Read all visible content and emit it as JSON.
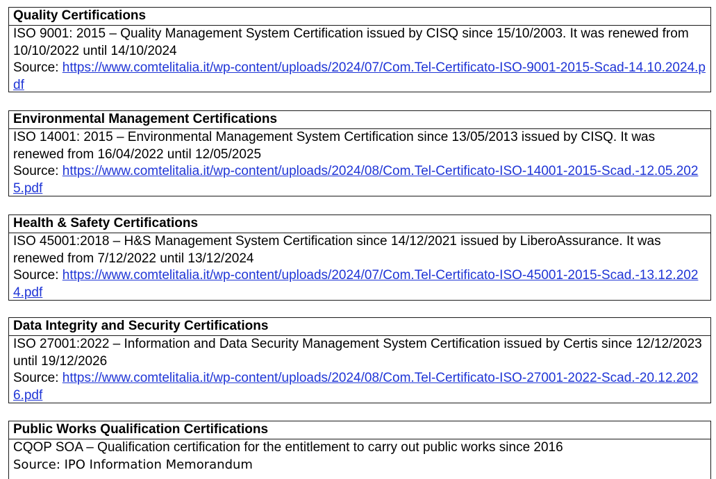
{
  "sections": [
    {
      "title": "Quality Certifications",
      "description": "ISO 9001: 2015 – Quality Management System Certification issued by CISQ since 15/10/2003. It was renewed from 10/10/2022 until 14/10/2024",
      "source_label": "Source: ",
      "source_link": "https://www.comtelitalia.it/wp-content/uploads/2024/07/Com.Tel-Certificato-ISO-9001-2015-Scad-14.10.2024.pdf"
    },
    {
      "title": "Environmental Management Certifications",
      "description": "ISO 14001: 2015 – Environmental Management System Certification since 13/05/2013 issued by CISQ. It was renewed from 16/04/2022 until 12/05/2025",
      "source_label": "Source: ",
      "source_link": "https://www.comtelitalia.it/wp-content/uploads/2024/08/Com.Tel-Certificato-ISO-14001-2015-Scad.-12.05.2025.pdf"
    },
    {
      "title": "Health & Safety Certifications",
      "description": "ISO 45001:2018 – H&S Management System Certification since 14/12/2021 issued by LiberoAssurance. It was renewed from 7/12/2022 until 13/12/2024",
      "source_label": "Source: ",
      "source_link": "https://www.comtelitalia.it/wp-content/uploads/2024/07/Com.Tel-Certificato-ISO-45001-2015-Scad.-13.12.2024.pdf"
    },
    {
      "title": "Data Integrity and Security Certifications",
      "description": "ISO 27001:2022 – Information and Data Security Management System Certification issued by Certis since 12/12/2023 until 19/12/2026",
      "source_label": "Source: ",
      "source_link": "https://www.comtelitalia.it/wp-content/uploads/2024/08/Com.Tel-Certificato-ISO-27001-2022-Scad.-20.12.2026.pdf"
    },
    {
      "title": "Public Works Qualification Certifications",
      "description": "CQOP SOA – Qualification certification for the entitlement to carry out public works since 2016",
      "source_text": "Source: IPO Information Memorandum"
    }
  ]
}
